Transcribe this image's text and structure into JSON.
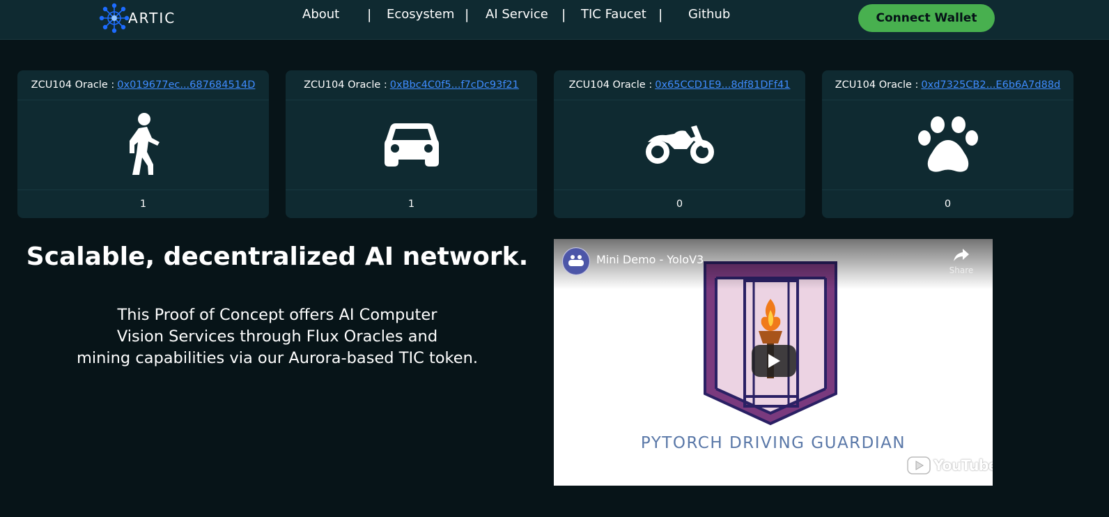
{
  "nav": {
    "brand": "ARTIC",
    "links": [
      "About",
      "Ecosystem",
      "AI Service",
      "TIC Faucet",
      "Github"
    ],
    "separator": "|",
    "connect_label": "Connect Wallet"
  },
  "oracles": [
    {
      "label": "ZCU104 Oracle :",
      "address": "0x019677ec...687684514D",
      "icon": "pedestrian-icon",
      "count": "1"
    },
    {
      "label": "ZCU104 Oracle :",
      "address": "0xBbc4C0f5...f7cDc93f21",
      "icon": "car-icon",
      "count": "1"
    },
    {
      "label": "ZCU104 Oracle :",
      "address": "0x65CCD1E9...8df81DFf41",
      "icon": "motorcycle-icon",
      "count": "0"
    },
    {
      "label": "ZCU104 Oracle :",
      "address": "0xd7325CB2...E6b6A7d88d",
      "icon": "paw-icon",
      "count": "0"
    }
  ],
  "hero": {
    "title": "Scalable, decentralized AI network.",
    "desc_lines": [
      "This Proof of Concept offers AI Computer",
      "Vision Services through Flux Oracles and",
      "mining capabilities via our Aurora-based TIC token."
    ]
  },
  "video": {
    "title": "Mini Demo - YoloV3",
    "share_label": "Share",
    "thumbnail_text": "PYTORCH DRIVING GUARDIAN",
    "youtube_label": "YouTube"
  },
  "colors": {
    "background": "#071418",
    "panel": "#0f2a31",
    "accent_green": "#48b04f",
    "link_blue": "#3f8cff"
  }
}
